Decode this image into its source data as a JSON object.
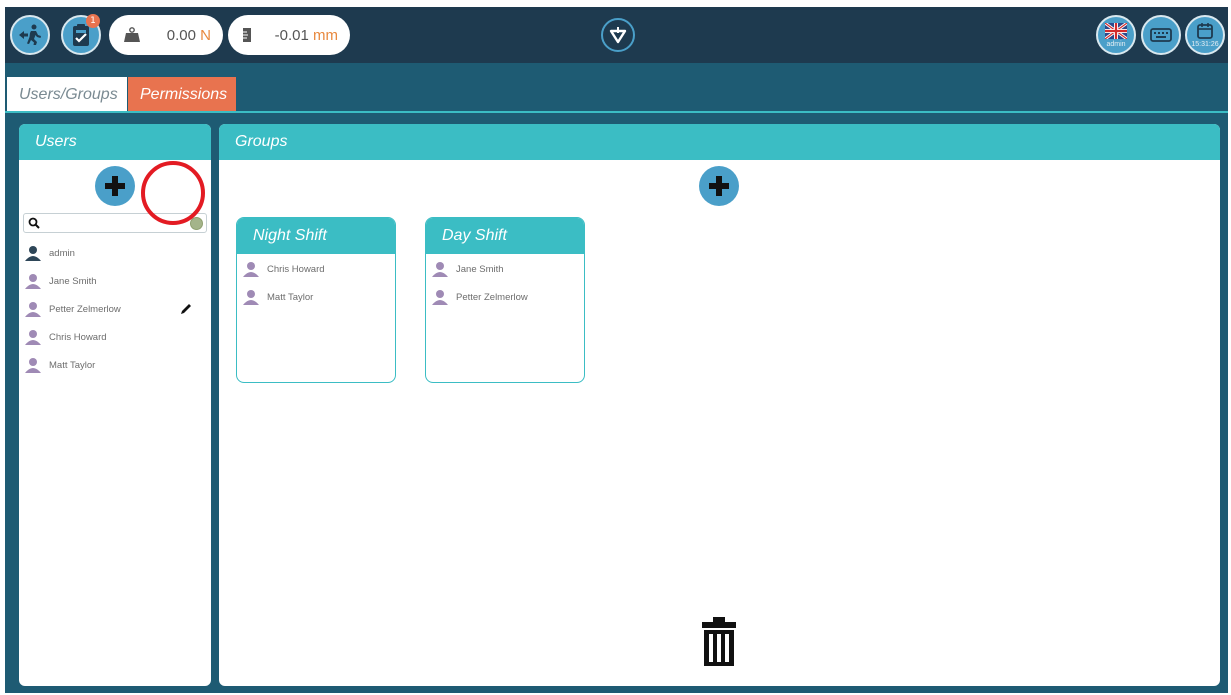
{
  "topbar": {
    "exit_icon": "exit-running-icon",
    "task_badge": "1",
    "force": {
      "value": "0.00",
      "unit": "N"
    },
    "position": {
      "value": "-0.01",
      "unit": "mm"
    },
    "user_label": "admin",
    "clock": "15:31:26"
  },
  "tabs": [
    {
      "label": "Users/Groups"
    },
    {
      "label": "Permissions"
    }
  ],
  "users_panel": {
    "title": "Users",
    "search_placeholder": "",
    "users": [
      {
        "name": "admin",
        "admin": true
      },
      {
        "name": "Jane Smith"
      },
      {
        "name": "Petter Zelmerlow"
      },
      {
        "name": "Chris Howard"
      },
      {
        "name": "Matt Taylor"
      }
    ]
  },
  "groups_panel": {
    "title": "Groups",
    "groups": [
      {
        "name": "Night Shift",
        "members": [
          "Chris Howard",
          "Matt Taylor"
        ]
      },
      {
        "name": "Day Shift",
        "members": [
          "Jane Smith",
          "Petter Zelmerlow"
        ]
      }
    ]
  },
  "colors": {
    "accent_teal": "#3bbdc4",
    "accent_orange": "#e8734f",
    "background_blue": "#1e5b73",
    "topbar": "#1e3a4f",
    "button_blue": "#4a9fc9",
    "highlight_red": "#e31b23"
  }
}
